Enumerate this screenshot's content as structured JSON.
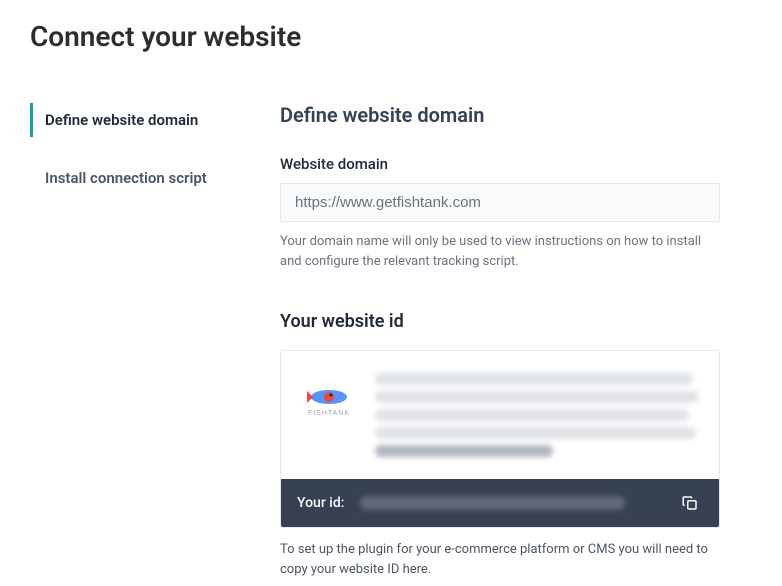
{
  "page": {
    "title": "Connect your website"
  },
  "sidebar": {
    "items": [
      {
        "label": "Define website domain",
        "active": true
      },
      {
        "label": "Install connection script",
        "active": false
      }
    ]
  },
  "main": {
    "section_title": "Define website domain",
    "domain_field": {
      "label": "Website domain",
      "value": "https://www.getfishtank.com",
      "help": "Your domain name will only be used to view instructions on how to install and configure the relevant tracking script."
    },
    "website_id": {
      "title": "Your website id",
      "logo_name": "fishtank-logo",
      "id_label": "Your id:",
      "footer_help": "To set up the plugin for your e-commerce platform or CMS you will need to copy your website ID here."
    }
  }
}
